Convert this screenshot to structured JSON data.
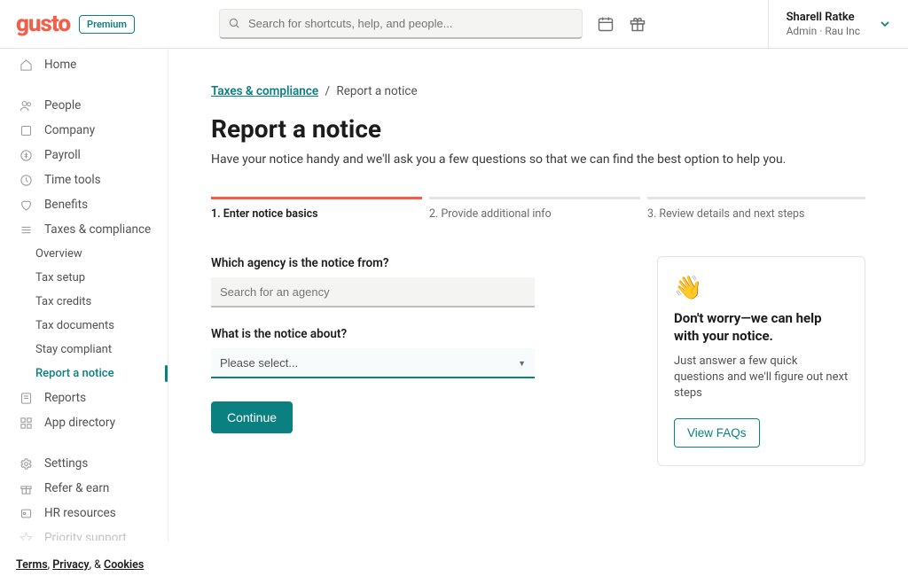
{
  "header": {
    "logo": "gusto",
    "badge": "Premium",
    "search_placeholder": "Search for shortcuts, help, and people...",
    "user": {
      "name": "Sharell Ratke",
      "sub": "Admin · Rau Inc"
    }
  },
  "sidebar": {
    "home": "Home",
    "people": "People",
    "company": "Company",
    "payroll": "Payroll",
    "time_tools": "Time tools",
    "benefits": "Benefits",
    "taxes": "Taxes & compliance",
    "taxes_sub": {
      "overview": "Overview",
      "tax_setup": "Tax setup",
      "tax_credits": "Tax credits",
      "tax_documents": "Tax documents",
      "stay_compliant": "Stay compliant",
      "report_notice": "Report a notice"
    },
    "reports": "Reports",
    "app_directory": "App directory",
    "settings": "Settings",
    "refer": "Refer & earn",
    "hr": "HR resources",
    "priority": "Priority support"
  },
  "footer": {
    "terms": "Terms",
    "privacy": "Privacy",
    "amp": ", & ",
    "cookies": "Cookies",
    "comma": ", "
  },
  "breadcrumb": {
    "root": "Taxes & compliance",
    "sep": "/",
    "current": "Report a notice"
  },
  "page": {
    "title": "Report a notice",
    "subtitle": "Have your notice handy and we'll ask you a few questions so that we can find the best option to help you."
  },
  "steps": {
    "s1": "1. Enter notice basics",
    "s2": "2. Provide additional info",
    "s3": "3. Review details and next steps"
  },
  "form": {
    "agency_label": "Which agency is the notice from?",
    "agency_placeholder": "Search for an agency",
    "about_label": "What is the notice about?",
    "about_placeholder": "Please select...",
    "continue": "Continue"
  },
  "panel": {
    "title": "Don't worry—we can help with your notice.",
    "text": "Just answer a few quick questions and we'll figure out next steps",
    "cta": "View FAQs"
  }
}
